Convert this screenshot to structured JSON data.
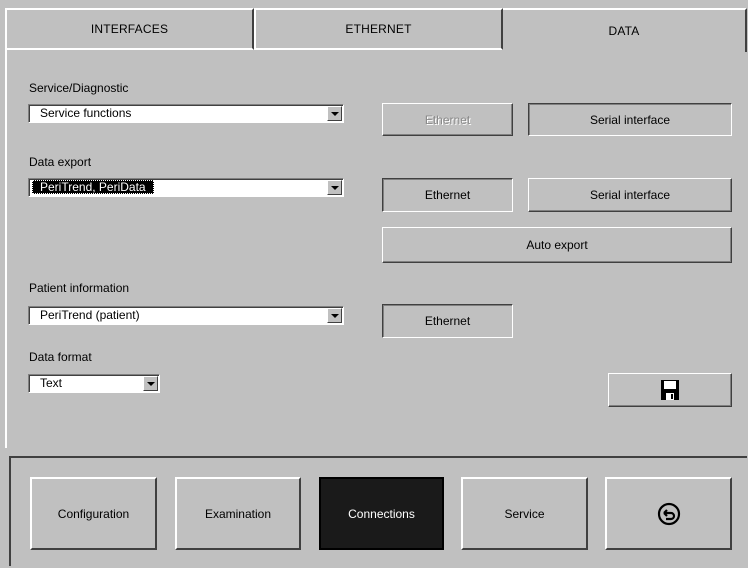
{
  "tabs": [
    {
      "label": "INTERFACES",
      "active": false
    },
    {
      "label": "ETHERNET",
      "active": false
    },
    {
      "label": "DATA",
      "active": true
    }
  ],
  "service": {
    "label": "Service/Diagnostic",
    "selected": "Service functions",
    "ethernet_button": "Ethernet",
    "serial_button": "Serial interface"
  },
  "export": {
    "label": "Data export",
    "selected": "PeriTrend, PeriData",
    "ethernet_button": "Ethernet",
    "serial_button": "Serial interface",
    "auto_button": "Auto export"
  },
  "patient": {
    "label": "Patient information",
    "selected": "PeriTrend (patient)",
    "ethernet_button": "Ethernet"
  },
  "format": {
    "label": "Data format",
    "selected": "Text"
  },
  "save_icon": "floppy-disk-icon",
  "nav": {
    "configuration": "Configuration",
    "examination": "Examination",
    "connections": "Connections",
    "service": "Service",
    "back_icon": "back-arrow-icon"
  }
}
